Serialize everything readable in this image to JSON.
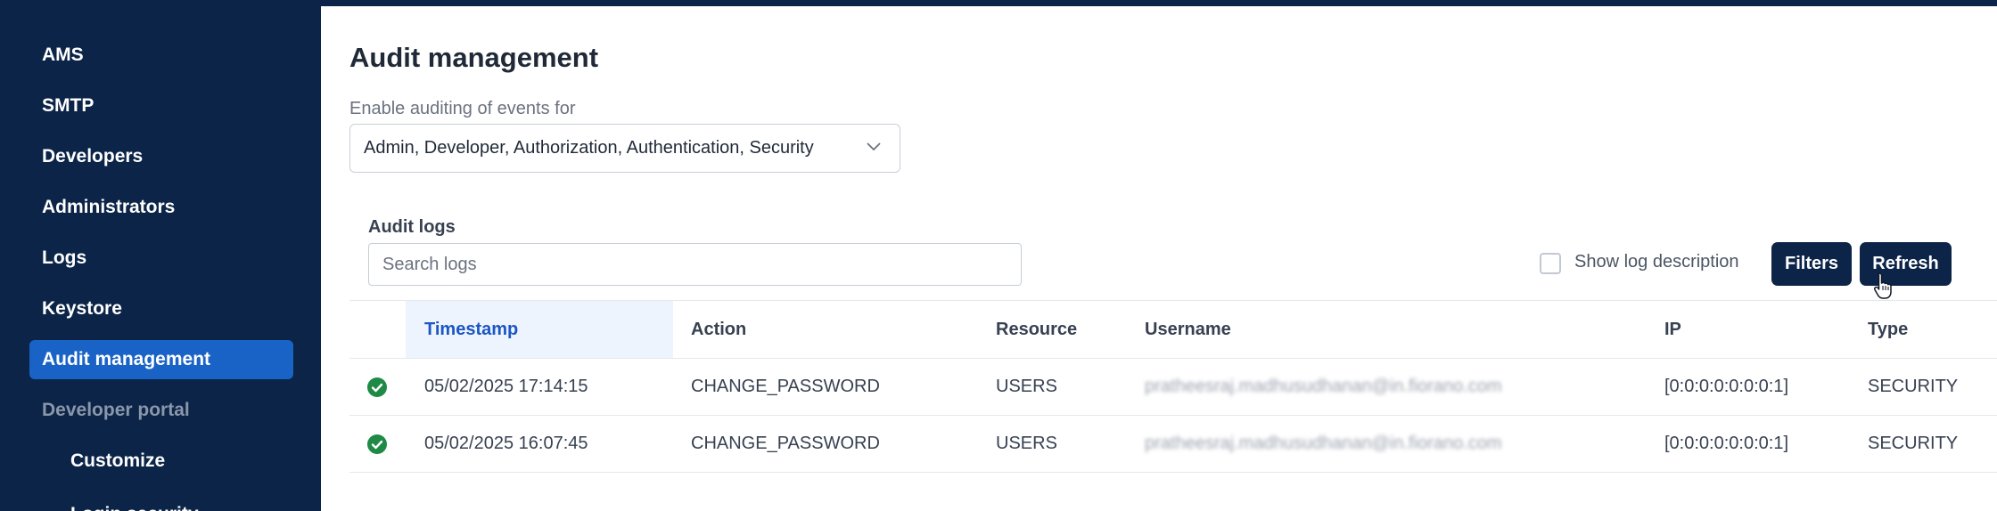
{
  "sidebar": {
    "items": [
      {
        "label": "AMS"
      },
      {
        "label": "SMTP"
      },
      {
        "label": "Developers"
      },
      {
        "label": "Administrators"
      },
      {
        "label": "Logs"
      },
      {
        "label": "Keystore"
      },
      {
        "label": "Audit management"
      },
      {
        "label": "Developer portal"
      },
      {
        "label": "Customize"
      },
      {
        "label": "Login security"
      }
    ]
  },
  "main": {
    "title": "Audit management",
    "auditing": {
      "label": "Enable auditing of events for",
      "value": "Admin, Developer, Authorization, Authentication, Security"
    },
    "logs": {
      "label": "Audit logs",
      "search_placeholder": "Search logs",
      "show_description_label": "Show log description",
      "filters_label": "Filters",
      "refresh_label": "Refresh"
    },
    "table": {
      "columns": [
        "Timestamp",
        "Action",
        "Resource",
        "Username",
        "IP",
        "Type"
      ],
      "rows": [
        {
          "timestamp": "05/02/2025 17:14:15",
          "action": "CHANGE_PASSWORD",
          "resource": "USERS",
          "username": "pratheesraj.madhusudhanan@in.fiorano.com",
          "ip": "[0:0:0:0:0:0:0:1]",
          "type": "SECURITY"
        },
        {
          "timestamp": "05/02/2025 16:07:45",
          "action": "CHANGE_PASSWORD",
          "resource": "USERS",
          "username": "pratheesraj.madhusudhanan@in.fiorano.com",
          "ip": "[0:0:0:0:0:0:0:1]",
          "type": "SECURITY"
        }
      ]
    }
  },
  "colors": {
    "navy": "#0b2447",
    "active_blue": "#1a63c6",
    "success_green": "#1e8a45",
    "sorted_header_bg": "#eef4fd"
  },
  "icons": {
    "status": "check-circle-icon",
    "dropdown": "chevron-down-icon",
    "cursor": "hand-pointer-icon"
  }
}
